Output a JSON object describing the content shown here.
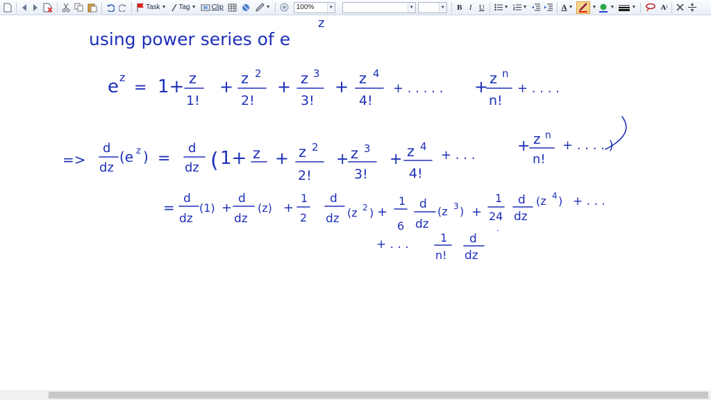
{
  "toolbar": {
    "task_label": "Task",
    "tag_label": "Tag",
    "clip_label": "Clip",
    "zoom_value": "100%",
    "font_name_value": "",
    "font_size_value": "",
    "bold_label": "B",
    "italic_label": "I",
    "underline_label": "U",
    "font_color_label": "A",
    "superscript_label": "A",
    "icons": [
      "new-page-icon",
      "prev-page-icon",
      "next-page-icon",
      "delete-page-icon",
      "cut-icon",
      "copy-icon",
      "paste-icon",
      "undo-icon",
      "redo-icon",
      "task-flag-icon",
      "tag-pen-icon",
      "clip-icon",
      "table-icon",
      "insert-image-icon",
      "pen-tool-icon",
      "refresh-icon",
      "bullets-icon",
      "numbering-icon",
      "decrease-indent-icon",
      "increase-indent-icon",
      "highlighter-icon",
      "fill-color-icon",
      "line-weight-icon",
      "lasso-icon",
      "close-icon",
      "align-icon"
    ]
  },
  "note": {
    "line1": "using power series of e",
    "line1_sup": "z",
    "row2": {
      "lhs": "e",
      "lhs_sup": "z",
      "eq": "=",
      "one": "1+",
      "t1_num": "z",
      "t1_den": "1!",
      "t2_num": "z",
      "t2_sup": "2",
      "t2_den": "2!",
      "t3_num": "z",
      "t3_sup": "3",
      "t3_den": "3!",
      "t4_num": "z",
      "t4_sup": "4",
      "t4_den": "4!",
      "dots1": "+ . . . . .",
      "tn_num": "z",
      "tn_sup": "n",
      "tn_den": "n!",
      "dots2": "+ . . . ."
    },
    "row3": {
      "arrow": "=>",
      "d_num": "d",
      "d_den": "dz",
      "paren_lhs": "(e",
      "paren_sup": "z",
      "paren_rhs": ")",
      "eq": "=",
      "d2_num": "d",
      "d2_den": "dz",
      "open": "(",
      "one": "1+",
      "t1_num": "z",
      "t2_num": "z",
      "t2_sup": "2",
      "t2_den": "2!",
      "t3_num": "z",
      "t3_sup": "3",
      "t3_den": "3!",
      "t4_num": "z",
      "t4_sup": "4",
      "t4_den": "4!",
      "dots1": "+ . . .",
      "tn_num": "z",
      "tn_sup": "n",
      "tn_den": "n!",
      "dots2": "+ . . . . )"
    },
    "row4": {
      "eq": "=",
      "a_num": "d",
      "a_den": "dz",
      "a_arg": "(1)",
      "b_num": "d",
      "b_den": "dz",
      "b_arg": "(z)",
      "c_coef_num": "1",
      "c_coef_den": "2",
      "c_num": "d",
      "c_den": "dz",
      "c_arg": "(z",
      "c_sup": "2",
      "c_close": ")",
      "e_coef_num": "1",
      "e_coef_den": "6",
      "e_num": "d",
      "e_den": "dz",
      "e_arg": "(z",
      "e_sup": "3",
      "e_close": ")",
      "f_coef_num": "1",
      "f_coef_den": "24",
      "f_num": "d",
      "f_den": "dz",
      "f_arg": "(z",
      "f_sup": "4",
      "f_close": ")",
      "dots": "+ . . ."
    },
    "row5": {
      "lead": "+ . . .",
      "coef_num": "1",
      "coef_den": "n!",
      "d_num": "d",
      "d_den": "dz"
    }
  }
}
